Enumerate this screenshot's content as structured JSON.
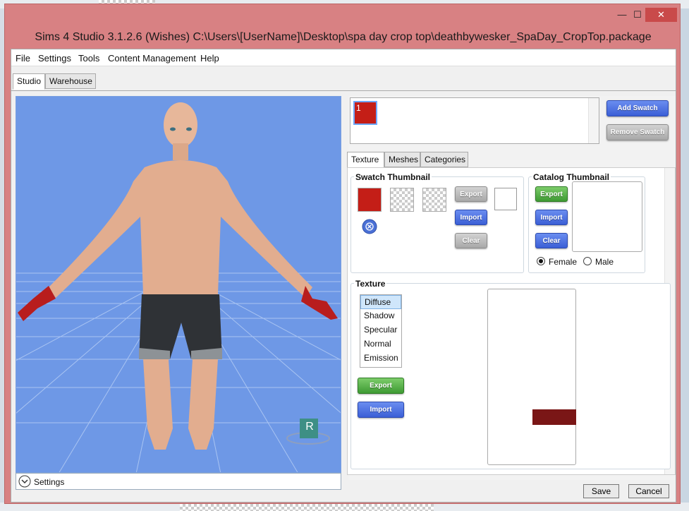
{
  "window": {
    "title": "Sims 4 Studio 3.1.2.6 (Wishes)  C:\\Users\\[UserName]\\Desktop\\spa day crop top\\deathbywesker_SpaDay_CropTop.package",
    "minimize": "—",
    "maximize": "☐",
    "close": "✕"
  },
  "menu": [
    "File",
    "Settings",
    "Tools",
    "Content Management",
    "Help"
  ],
  "main_tabs": [
    "Studio",
    "Warehouse"
  ],
  "viewport": {
    "settings_label": "Settings",
    "badge": "R"
  },
  "swatches": {
    "items": [
      {
        "label": "1",
        "color": "#c41e17"
      }
    ],
    "add_label": "Add Swatch",
    "remove_label": "Remove Swatch"
  },
  "editor_tabs": [
    "Texture",
    "Meshes",
    "Categories"
  ],
  "swatch_thumbnail": {
    "title": "Swatch Thumbnail",
    "export": "Export",
    "import": "Import",
    "clear": "Clear"
  },
  "catalog_thumbnail": {
    "title": "Catalog Thumbnail",
    "export": "Export",
    "import": "Import",
    "clear": "Clear",
    "female": "Female",
    "male": "Male",
    "selected_gender": "Female"
  },
  "texture": {
    "title": "Texture",
    "types": [
      "Diffuse",
      "Shadow",
      "Specular",
      "Normal",
      "Emission"
    ],
    "selected": "Diffuse",
    "export": "Export",
    "import": "Import"
  },
  "footer": {
    "save": "Save",
    "cancel": "Cancel"
  },
  "colors": {
    "window_frame": "#d88183",
    "viewport_bg": "#6e98e6",
    "accent_red": "#c41e17"
  }
}
